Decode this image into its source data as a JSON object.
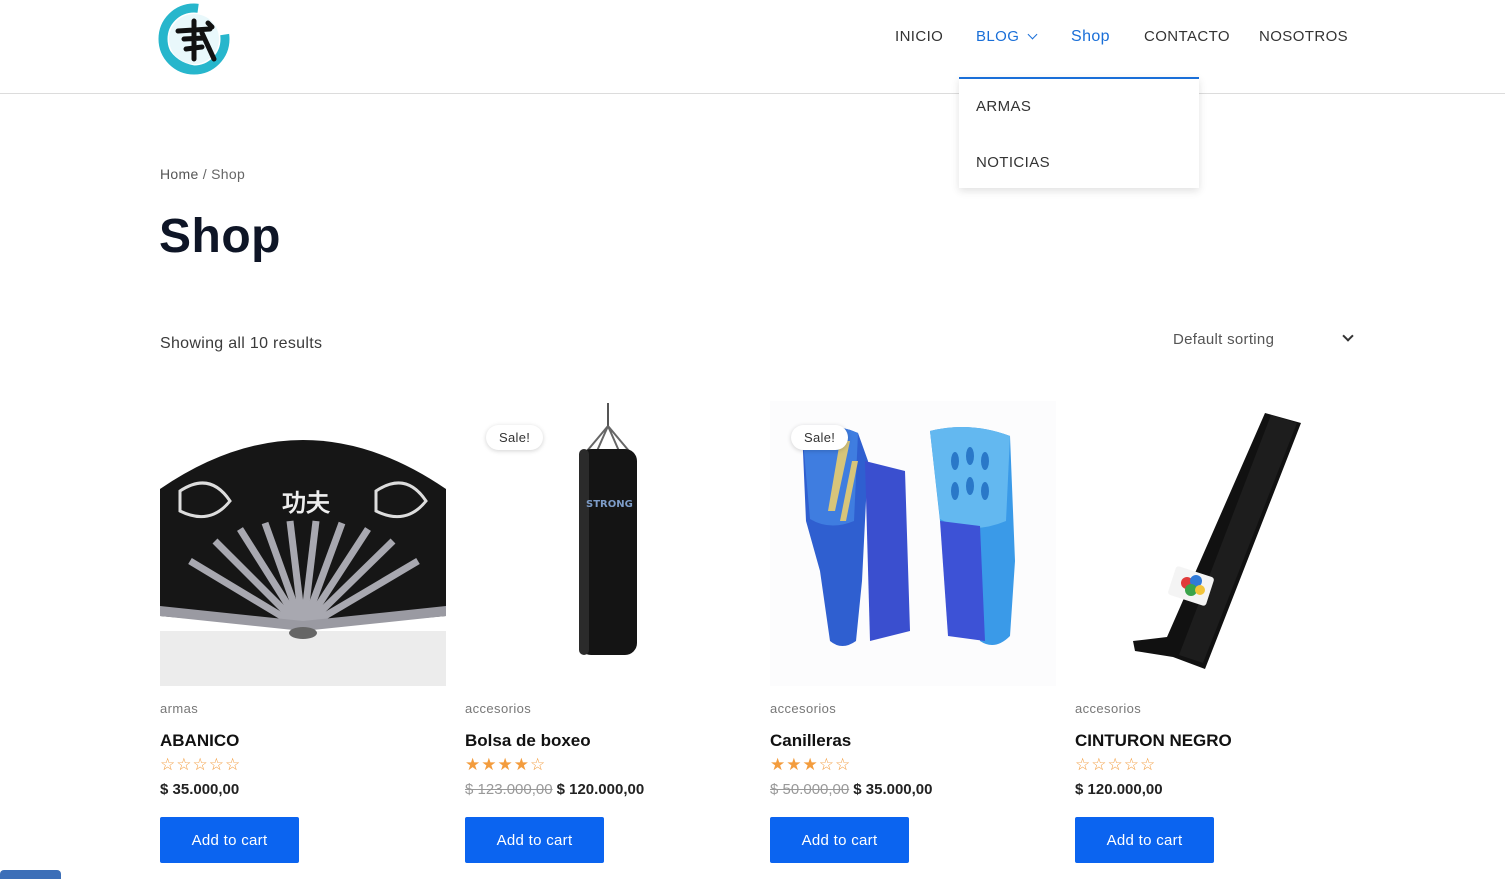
{
  "header": {
    "logo_icon": "wu-kanji-logo",
    "nav": [
      {
        "label": "INICIO"
      },
      {
        "label": "BLOG"
      },
      {
        "label": "Shop"
      },
      {
        "label": "CONTACTO"
      },
      {
        "label": "NOSOTROS"
      }
    ],
    "dropdown": [
      {
        "label": "ARMAS"
      },
      {
        "label": "NOTICIAS"
      }
    ],
    "accent_color": "#1a6fd8"
  },
  "breadcrumb": {
    "home": "Home",
    "separator": "/",
    "current": "Shop"
  },
  "page_title": "Shop",
  "results_text": "Showing all 10 results",
  "sorting": {
    "selected": "Default sorting"
  },
  "products": [
    {
      "category": "armas",
      "name": "ABANICO",
      "rating": 0,
      "rating_stars": "☆☆☆☆☆",
      "old_price": "",
      "price": "$ 35.000,00",
      "sale_badge": "",
      "button": "Add to cart",
      "image": "black-folding-fan"
    },
    {
      "category": "accesorios",
      "name": "Bolsa de boxeo",
      "rating": 4,
      "rating_stars": "★★★★☆",
      "old_price": "$ 123.000,00",
      "price": "$ 120.000,00",
      "sale_badge": "Sale!",
      "button": "Add to cart",
      "image": "punching-bag"
    },
    {
      "category": "accesorios",
      "name": "Canilleras",
      "rating": 3,
      "rating_stars": "★★★☆☆",
      "old_price": "$ 50.000,00",
      "price": "$ 35.000,00",
      "sale_badge": "Sale!",
      "button": "Add to cart",
      "image": "blue-shin-guards"
    },
    {
      "category": "accesorios",
      "name": "CINTURON NEGRO",
      "rating": 0,
      "rating_stars": "☆☆☆☆☆",
      "old_price": "",
      "price": "$ 120.000,00",
      "sale_badge": "",
      "button": "Add to cart",
      "image": "black-belt"
    }
  ],
  "button_color": "#0b64f0",
  "star_color": "#f39c3d"
}
